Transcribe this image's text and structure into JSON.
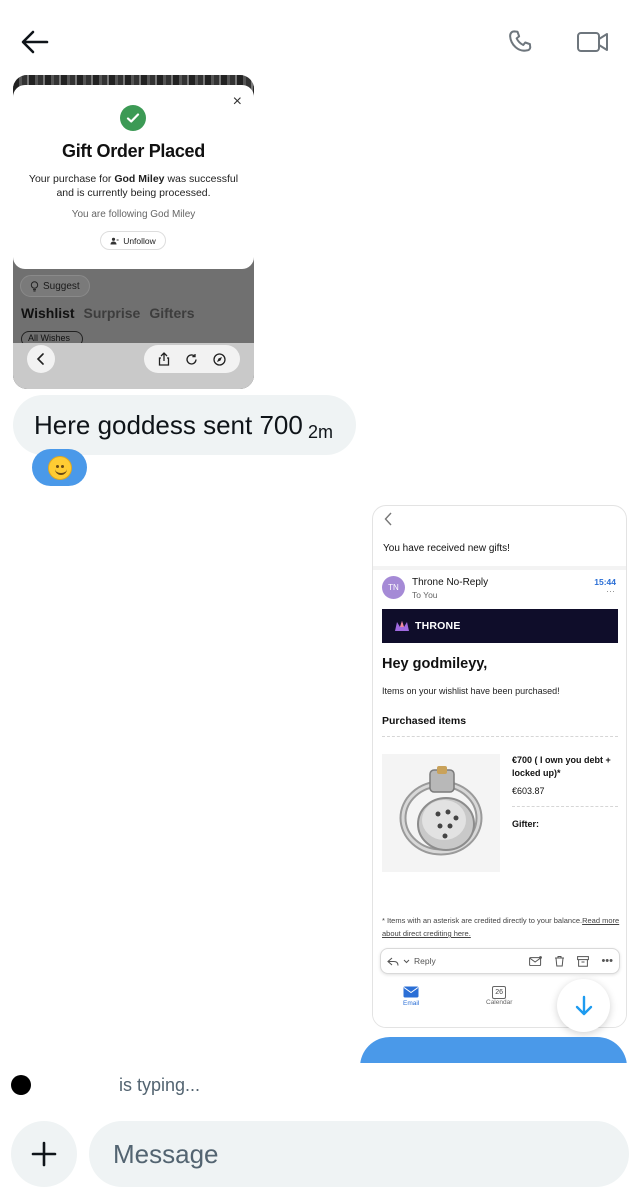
{
  "header": {
    "back_icon": "arrow-left-icon",
    "call_icon": "phone-icon",
    "video_icon": "video-camera-icon"
  },
  "messages": {
    "gift_screenshot": {
      "close": "×",
      "title": "Gift Order Placed",
      "body_prefix": "Your purchase for ",
      "body_name": "God Miley",
      "body_suffix": " was successful and is currently being processed.",
      "following": "You are following God Miley",
      "unfollow": "Unfollow",
      "suggest": "Suggest",
      "tabs": [
        "Wishlist",
        "Surprise",
        "Gifters"
      ],
      "filter": "All Wishes"
    },
    "text_bubble": {
      "text": "Here goddess sent 700",
      "time": "2m",
      "reaction": "smiling-face-emoji"
    },
    "email_screenshot": {
      "subject": "You have received new gifts!",
      "avatar": "TN",
      "from": "Throne No-Reply",
      "to": "To You",
      "time": "15:44",
      "more": "···",
      "brand": "THRONE",
      "greeting": "Hey godmileyy,",
      "intro": "Items on your wishlist have been purchased!",
      "section": "Purchased items",
      "item_title": "€700 ( I own you debt + locked up)*",
      "item_amount": "€603.87",
      "gifter_label": "Gifter:",
      "footnote": "* Items with an asterisk are credited directly to your balance.",
      "footnote_link": "Read more about direct crediting here.",
      "reply": "Reply",
      "tab_email": "Email",
      "tab_calendar": "Calendar",
      "calendar_day": "26"
    }
  },
  "typing_indicator": "is typing...",
  "composer": {
    "placeholder": "Message"
  },
  "colors": {
    "accent_blue": "#4a99e9",
    "bubble_gray": "#eff3f4",
    "success_green": "#3c9a55",
    "throne_navy": "#0f0d2a"
  }
}
